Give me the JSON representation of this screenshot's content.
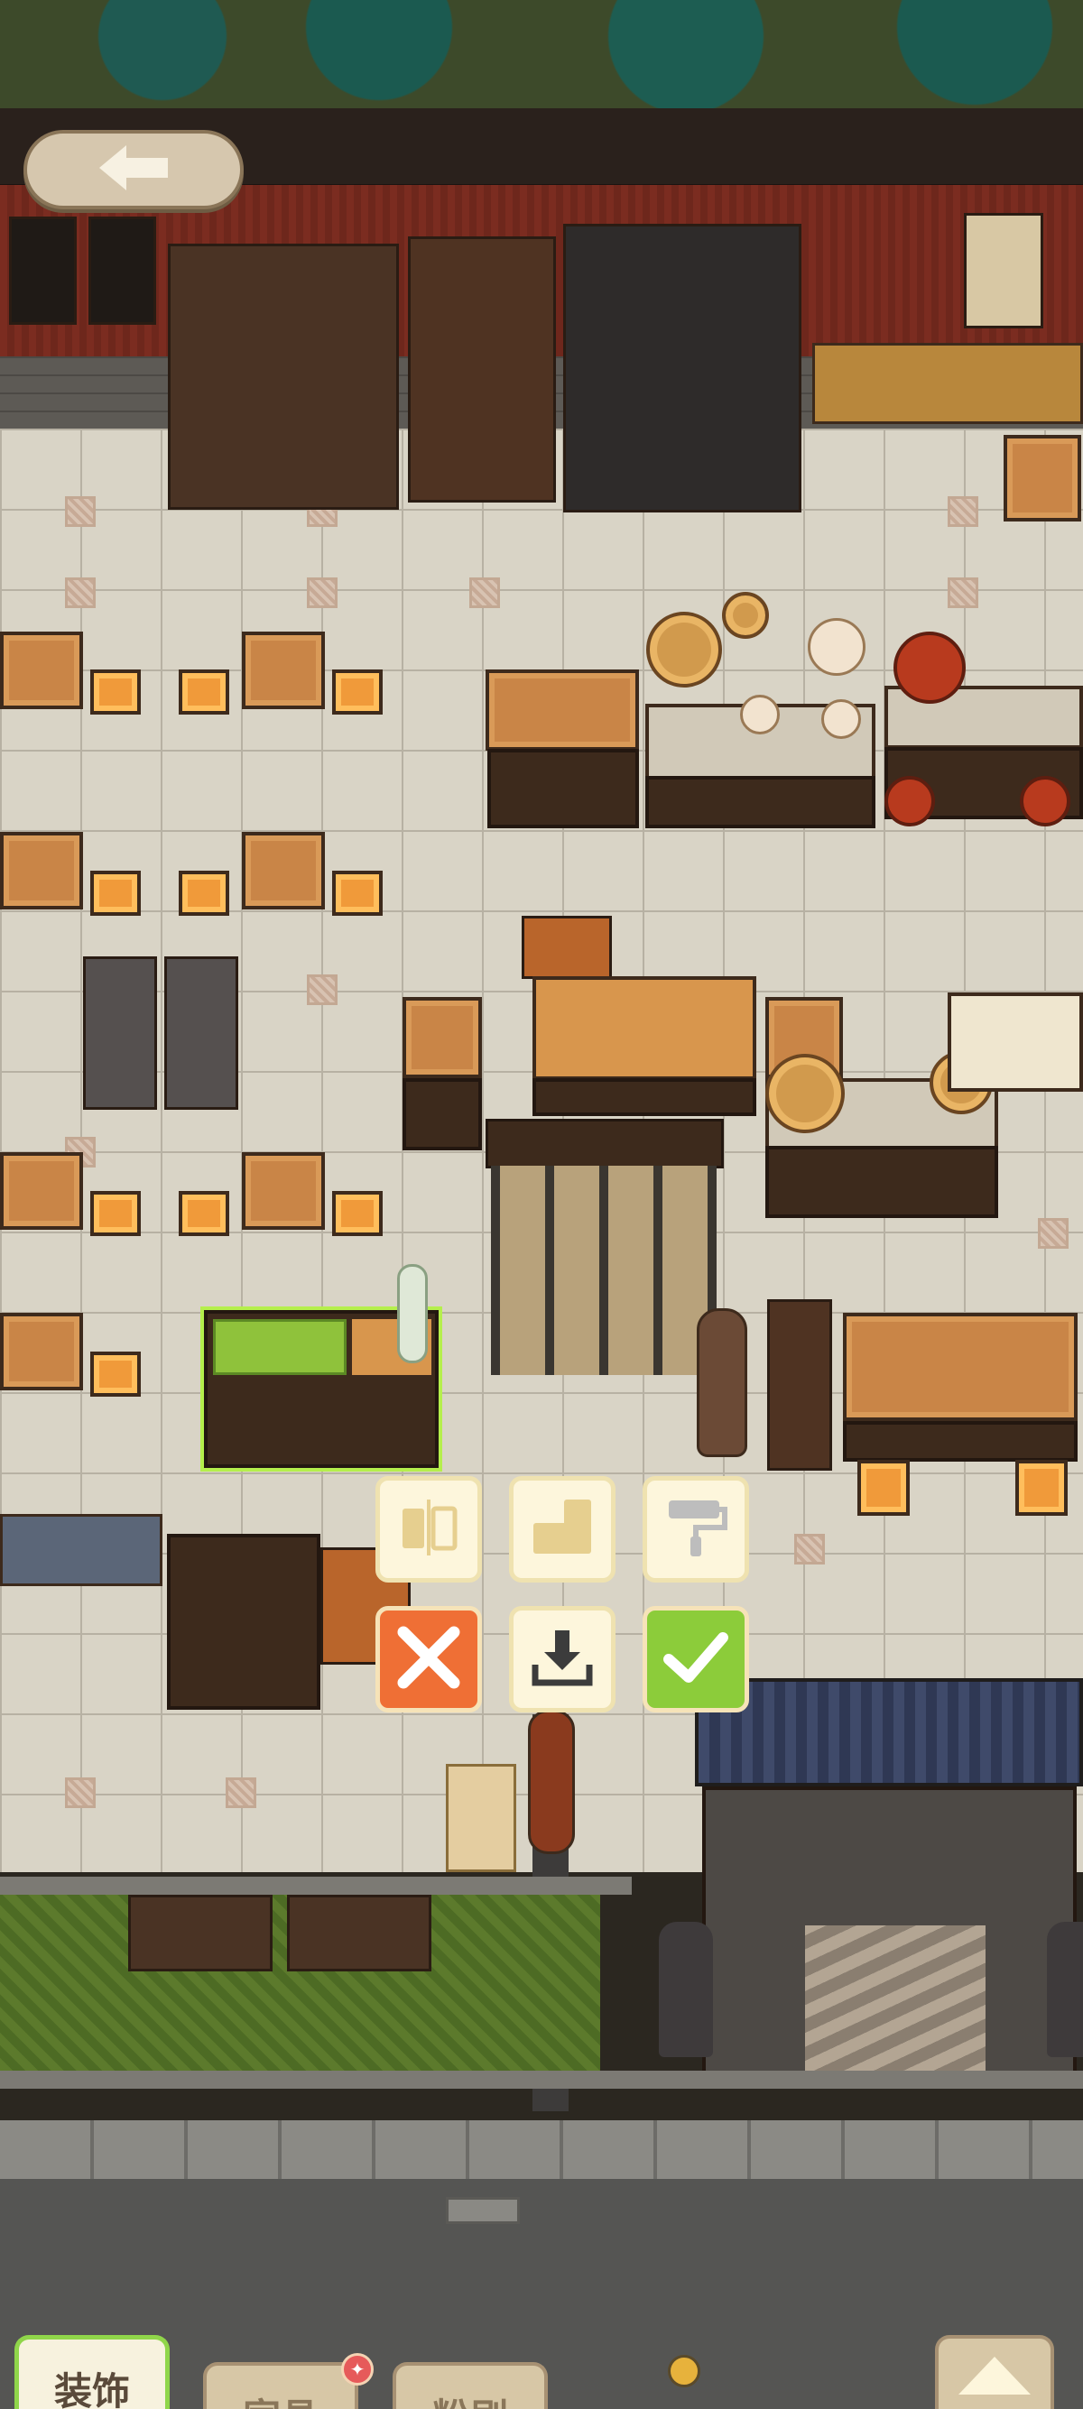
{
  "top_bar": {
    "back_button": {
      "icon": "arrow-left-icon"
    }
  },
  "edit_toolbar": {
    "row1": [
      {
        "icon": "flip-horizontal-icon",
        "enabled": true
      },
      {
        "icon": "rotate-shape-icon",
        "enabled": true
      },
      {
        "icon": "paint-roller-icon",
        "enabled": false
      }
    ],
    "row2": [
      {
        "icon": "close-x-icon",
        "action": "cancel"
      },
      {
        "icon": "store-download-icon",
        "action": "store"
      },
      {
        "icon": "checkmark-icon",
        "action": "confirm"
      }
    ]
  },
  "bottom_tabs": [
    {
      "label": "装饰",
      "active": true
    },
    {
      "label": "家具",
      "active": false,
      "notification": true
    },
    {
      "label": "粉刷",
      "active": false
    }
  ],
  "expand_button": {
    "icon": "triangle-up-icon"
  },
  "colors": {
    "accent_green": "#8ccc3a",
    "cancel_orange": "#ef6f35",
    "panel_cream": "#fdf6dc",
    "tab_tan": "#d7c7a6"
  }
}
